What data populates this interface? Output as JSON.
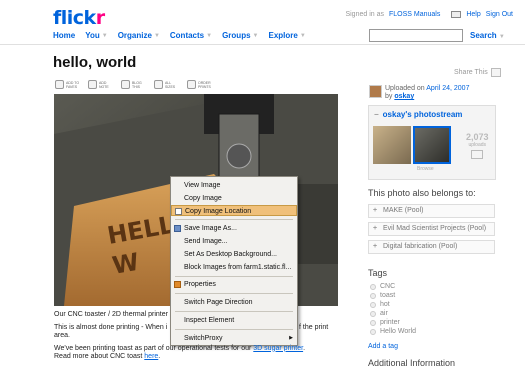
{
  "header": {
    "logo_main": "flick",
    "logo_accent": "r",
    "signed_in_prefix": "Signed in as",
    "username": "FLOSS Manuals",
    "help": "Help",
    "sign_out": "Sign Out"
  },
  "nav": [
    "Home",
    "You",
    "Organize",
    "Contacts",
    "Groups",
    "Explore"
  ],
  "search": {
    "placeholder": "",
    "button": "Search"
  },
  "photo_page": {
    "title": "hello, world",
    "share": "Share This",
    "actions": [
      "Add to faves",
      "Add note",
      "Blog this",
      "All sizes",
      "Order prints"
    ]
  },
  "context_menu": [
    "View Image",
    "Copy Image",
    "Copy Image Location",
    "Save Image As...",
    "Send Image...",
    "Set As Desktop Background...",
    "Block Images from farm1.static.fl...",
    "Properties",
    "Switch Page Direction",
    "Inspect Element",
    "SwitchProxy"
  ],
  "caption": {
    "line1": "Our CNC toaster / 2D thermal printer",
    "line2a": "This is almost done printing - When i",
    "line2b": "f the print",
    "line2c": "area.",
    "line3a": "We've been printing toast as part of our operational tests for our",
    "line3link": "3D sugar printer",
    "line4a": "Read more about CNC toast",
    "line4link": "here"
  },
  "sidebar": {
    "uploaded_prefix": "Uploaded on",
    "uploaded_date": "April 24, 2007",
    "by": "by",
    "user": "oskay",
    "stream_title": "oskay's photostream",
    "count": "2,073",
    "count_caption": "uploads",
    "browse": "Browse",
    "belongs": "This photo also belongs to:",
    "pools": [
      "MAKE (Pool)",
      "Evil Mad Scientist Projects (Pool)",
      "Digital fabrication (Pool)"
    ],
    "tags_heading": "Tags",
    "tags": [
      "CNC",
      "toast",
      "hot",
      "air",
      "printer",
      "Hello World"
    ],
    "add_tag": "Add a tag",
    "additional": "Additional Information"
  },
  "colors": {
    "brand_blue": "#0063dc",
    "brand_pink": "#ff0084",
    "menu_highlight": "#f0c07a"
  }
}
